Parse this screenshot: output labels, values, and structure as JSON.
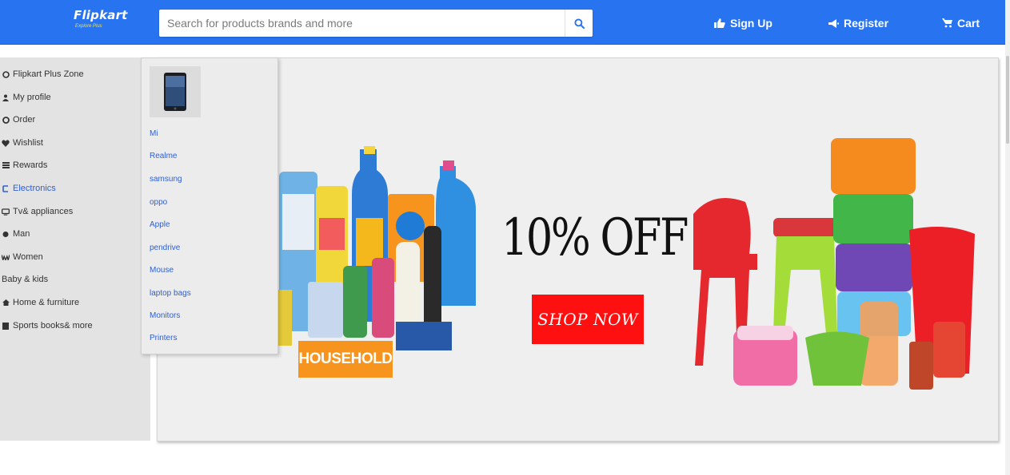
{
  "header": {
    "logo_text": "Flipkart",
    "logo_tagline": "Explore Plus",
    "search": {
      "placeholder": "Search for products brands and more"
    },
    "signup_label": "Sign Up",
    "register_label": "Register",
    "cart_label": "Cart",
    "brand_color": "#2874f0"
  },
  "sidebar": {
    "items": [
      {
        "label": "Flipkart Plus Zone",
        "icon": "plus-zone-icon"
      },
      {
        "label": "My profile",
        "icon": "user-icon"
      },
      {
        "label": "Order",
        "icon": "order-icon"
      },
      {
        "label": "Wishlist",
        "icon": "heart-icon"
      },
      {
        "label": "Rewards",
        "icon": "rewards-icon"
      },
      {
        "label": "Electronics",
        "icon": "electronics-icon",
        "active": true
      },
      {
        "label": "Tv& appliances",
        "icon": "tv-icon"
      },
      {
        "label": "Man",
        "icon": "man-icon"
      },
      {
        "label": "Women",
        "icon": "women-icon"
      },
      {
        "label": "Baby & kids",
        "icon": ""
      },
      {
        "label": "Home & furniture",
        "icon": "home-icon"
      },
      {
        "label": "Sports books& more",
        "icon": "book-icon"
      }
    ]
  },
  "dropdown": {
    "items": [
      "Mi",
      "Realme",
      "samsung",
      "oppo",
      "Apple",
      "pendrive",
      "Mouse",
      "laptop bags",
      "Monitors",
      "Printers"
    ]
  },
  "banner": {
    "offer_text": "10% OFF",
    "shop_button": "SHOP NOW",
    "household_label": "HOUSEHOLD",
    "accent_red": "#ff1010",
    "accent_orange": "#f7941d"
  }
}
